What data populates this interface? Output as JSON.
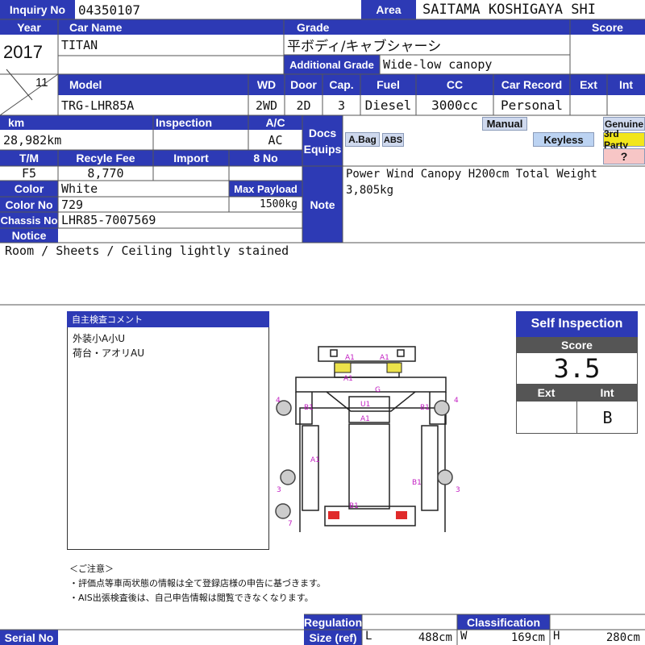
{
  "header": {
    "inquiry_label": "Inquiry No",
    "inquiry_no": "04350107",
    "area_label": "Area",
    "area": "SAITAMA KOSHIGAYA SHI",
    "year_label": "Year",
    "car_name_label": "Car Name",
    "grade_label": "Grade",
    "score_label": "Score",
    "year": "2017",
    "month": "11",
    "car_name": "TITAN",
    "grade": "平ボディ/キャブシャーシ",
    "additional_grade_label": "Additional Grade",
    "additional_grade": "Wide-low canopy"
  },
  "model_row": {
    "labels": {
      "model": "Model",
      "wd": "WD",
      "door": "Door",
      "cap": "Cap.",
      "fuel": "Fuel",
      "cc": "CC",
      "record": "Car Record",
      "ext": "Ext",
      "int": "Int"
    },
    "model": "TRG-LHR85A",
    "wd": "2WD",
    "door": "2D",
    "cap": "3",
    "fuel": "Diesel",
    "cc": "3000cc",
    "record": "Personal",
    "ext": "",
    "int": ""
  },
  "details": {
    "km_label": "km",
    "inspection_label": "Inspection",
    "ac_label": "A/C",
    "km": "28,982km",
    "inspection": "",
    "ac": "AC",
    "tm_label": "T/M",
    "recycle_label": "Recyle Fee",
    "import_label": "Import",
    "no8_label": "8 No",
    "tm": "F5",
    "recycle": "8,770",
    "import": "",
    "no8": "",
    "color_label": "Color",
    "color": "White",
    "payload_label": "Max Payload",
    "color_no_label": "Color No",
    "color_no": "729",
    "payload": "1500kg",
    "chassis_label": "Chassis No",
    "chassis": "LHR85-7007569",
    "notice_label": "Notice",
    "notice": "Room / Sheets / Ceiling lightly stained"
  },
  "equips": {
    "label_line1": "Docs",
    "label_line2": "Equips",
    "manual": "Manual",
    "genuine": "Genuine",
    "keyless": "Keyless",
    "third_party": "3rd Party",
    "abag": "A.Bag",
    "abs": "ABS",
    "question": "?",
    "colors": {
      "manual": "#cfd9ee",
      "abag": "#cfd9ee",
      "keyless": "#bcd3f2",
      "genuine": "#cfd9ee",
      "third_party": "#f2e61a",
      "question": "#f7c6c6"
    }
  },
  "note": {
    "label": "Note",
    "text_line1": "Power Wind Canopy H200cm Total Weight",
    "text_line2": "3,805kg"
  },
  "comment": {
    "title": "自主検査コメント",
    "line1": "外装小A小U",
    "line2": "荷台・アオリAU"
  },
  "diagram_marks": [
    "A1",
    "A1",
    "A1",
    "G",
    "U1",
    "A1",
    "B1",
    "B1",
    "A1",
    "B1",
    "B1",
    "4",
    "4",
    "3",
    "3",
    "7"
  ],
  "cautions": {
    "title": "＜ご注意＞",
    "line1": "・評価点等車両状態の情報は全て登録店様の申告に基づきます。",
    "line2": "・AIS出張検査後は、自己申告情報は閲覧できなくなります。"
  },
  "self_inspection": {
    "title": "Self Inspection",
    "score_label": "Score",
    "score": "3.5",
    "ext_label": "Ext",
    "int_label": "Int",
    "ext": "",
    "int": "B"
  },
  "footer": {
    "serial_label": "Serial No",
    "serial": "",
    "regulation_label": "Regulation",
    "size_label": "Size (ref)",
    "classification_label": "Classification",
    "l_label": "L",
    "l": "488cm",
    "w_label": "W",
    "w": "169cm",
    "h_label": "H",
    "h": "280cm"
  }
}
